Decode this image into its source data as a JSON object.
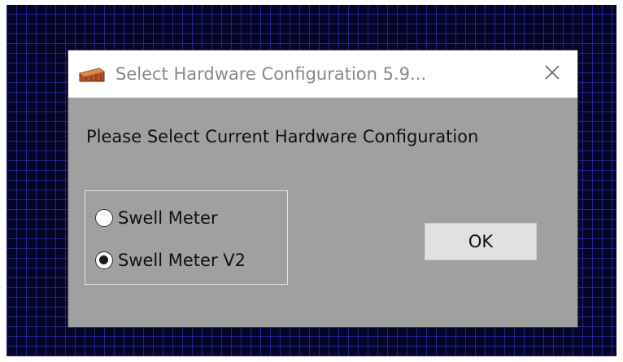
{
  "dialog": {
    "title": "Select Hardware Configuration  5.9...",
    "app_icon": "hardware-device-icon",
    "close_icon": "close-icon",
    "prompt": "Please Select Current Hardware Configuration",
    "options": [
      {
        "label": "Swell Meter",
        "selected": false
      },
      {
        "label": "Swell Meter V2",
        "selected": true
      }
    ],
    "ok_label": "OK"
  },
  "colors": {
    "desktop_background": "#05052a",
    "grid_lines": "#3c3cc8",
    "dialog_body": "#a0a0a0",
    "titlebar": "#ffffff",
    "title_text": "#8a8a8a",
    "icon_accent": "#b4502a"
  }
}
